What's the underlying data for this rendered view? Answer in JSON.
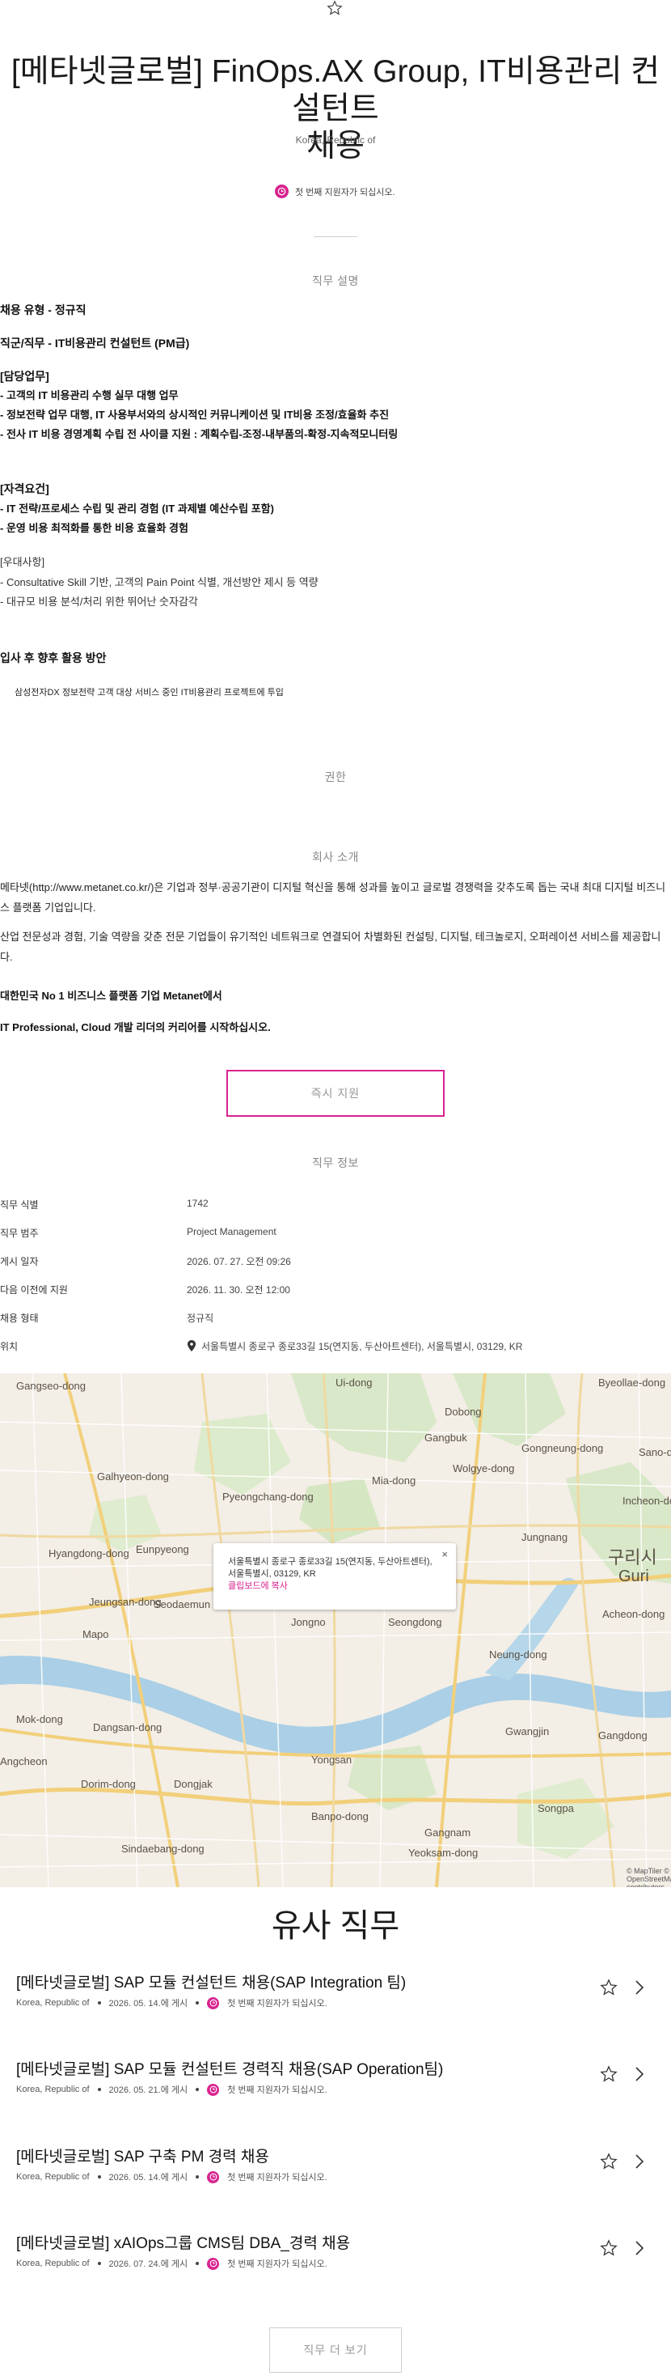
{
  "header": {
    "title_line1": "[메타넷글로벌] FinOps.AX Group, IT비용관리 컨설턴트",
    "title_line2": "채용",
    "location": "Korea, Republic of",
    "first_applicant": "첫 번째 지원자가 되십시오."
  },
  "sections": {
    "job_description": "직무 설명",
    "qualifications": "권한",
    "company_intro": "회사 소개",
    "job_info": "직무 정보",
    "similar_jobs": "유사 직무"
  },
  "description": {
    "employment_type": "채용 유형 - 정규직",
    "job_title": "직군/직무 - IT비용관리 컨설턴트 (PM급)",
    "duties_header": "[담당업무]",
    "duties": [
      " - 고객의 IT 비용관리 수행 실무 대행 업무",
      " - 정보전략 업무 대행, IT 사용부서와의 상시적인 커뮤니케이션 및 IT비용 조정/효율화 추진",
      " - 전사 IT 비용 경영계획 수립 전 사이클 지원 : 계획수립-조정-내부품의-확정-지속적모니터링"
    ],
    "requirements_header": "[자격요건]",
    "requirements": [
      " - IT 전략/프로세스 수립 및 관리 경험 (IT 과제별 예산수립 포함)",
      " - 운영 비용 최적화를 통한 비용 효율화 경험"
    ],
    "preferred_header": "[우대사항]",
    "preferred": [
      "- Consultative Skill 기반, 고객의 Pain Point 식별, 개선방안 제시 등 역량",
      "- 대규모 비용 분석/처리 위한 뛰어난 숫자감각"
    ],
    "after_join_header": "입사 후 향후 활용 방안",
    "after_join": "삼성전자DX 정보전략 고객 대상 서비스 중인 IT비용관리 프로젝트에 투입"
  },
  "company": {
    "paragraph1": "메타넷(http://www.metanet.co.kr/)은 기업과 정부·공공기관이 디지털 혁신을 통해 성과를 높이고 글로벌 경쟁력을 갖추도록 돕는 국내 최대 디지털 비즈니스 플랫폼 기업입니다.",
    "paragraph2": "산업 전문성과 경험, 기술 역량을 갖춘 전문 기업들이 유기적인 네트워크로 연결되어 차별화된 컨설팅, 디지털, 테크놀로지, 오퍼레이션 서비스를 제공합니다.",
    "tagline1": "대한민국 No 1 비즈니스 플랫폼 기업 Metanet에서",
    "tagline2": "IT Professional, Cloud 개발 리더의 커리어를 시작하십시오."
  },
  "apply_button": "즉시 지원",
  "job_info": [
    {
      "label": "직무 식별",
      "value": "1742"
    },
    {
      "label": "직무 범주",
      "value": "Project Management"
    },
    {
      "label": "게시 일자",
      "value": "2026. 07. 27. 오전 09:26"
    },
    {
      "label": "다음 이전에 지원",
      "value": "2026. 11. 30. 오전 12:00"
    },
    {
      "label": "채용 형태",
      "value": "정규직"
    },
    {
      "label": "위치",
      "value": "서울특별시 종로구 종로33길 15(연지동, 두산아트센터), 서울특별시, 03129, KR"
    }
  ],
  "map": {
    "popup_line1": "서울특별시 종로구 종로33길 15(연지동, 두산아트센터),",
    "popup_line2": "서울특별시, 03129, KR",
    "popup_copy": "클립보드에 복사",
    "popup_close": "×",
    "labels": [
      "Gangseo-dong",
      "Ui-dong",
      "Byeollae-dong",
      "Galhyeon-dong",
      "Pyeongchang-dong",
      "Eunpyeong",
      "Hyangdong-dong",
      "Jeungsan-dong",
      "Seodaemun",
      "Mapo",
      "Jongno",
      "Seongdong",
      "Gangbuk",
      "Jungnang",
      "구리시",
      "Guri",
      "Dobong",
      "Yongsan",
      "Dongjak",
      "Gangnam",
      "Songpa",
      "Gwangjin",
      "Gangdong",
      "Banpo-dong",
      "Yeoksam-dong",
      "Neung-dong",
      "Acheon-dong",
      "Gongneung-dong",
      "Wolgye-dong",
      "Mia-dong",
      "Incheon-dong",
      "Sano-dong",
      "Mok-dong",
      "Dangsan-dong",
      "Dorim-dong",
      "Sindaebang-dong",
      "Angcheon"
    ],
    "attribution": "© MapTiler © OpenStreetMap contributors"
  },
  "similar_jobs": [
    {
      "title": "[메타넷글로벌] SAP 모듈 컨설턴트 채용(SAP Integration 팀)",
      "location": "Korea, Republic of",
      "posted": "2026. 05. 14.에 게시",
      "first_applicant": "첫 번째 지원자가 되십시오."
    },
    {
      "title": "[메타넷글로벌] SAP 모듈 컨설턴트 경력직 채용(SAP Operation팀)",
      "location": "Korea, Republic of",
      "posted": "2026. 05. 21.에 게시",
      "first_applicant": "첫 번째 지원자가 되십시오."
    },
    {
      "title": "[메타넷글로벌] SAP 구축 PM 경력 채용",
      "location": "Korea, Republic of",
      "posted": "2026. 05. 14.에 게시",
      "first_applicant": "첫 번째 지원자가 되십시오."
    },
    {
      "title": "[메타넷글로벌] xAIOps그룹 CMS팀 DBA_경력 채용",
      "location": "Korea, Republic of",
      "posted": "2026. 07. 24.에 게시",
      "first_applicant": "첫 번째 지원자가 되십시오."
    }
  ],
  "more_jobs_button": "직무 더 보기",
  "colors": {
    "accent": "#d8238f",
    "text": "#111111",
    "muted": "#888888"
  }
}
